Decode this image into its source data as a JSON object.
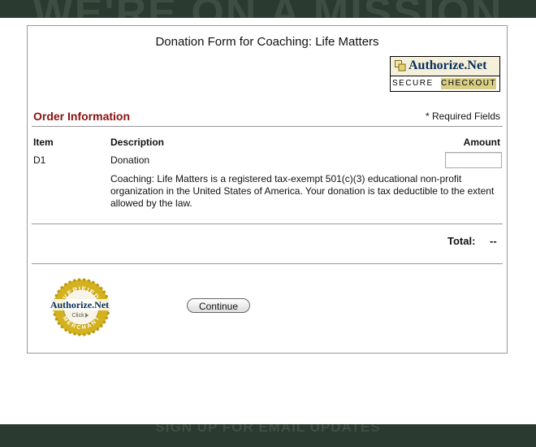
{
  "background": {
    "headline": "WE'RE ON A MISSION",
    "footer_text": "SIGN UP FOR EMAIL UPDATES"
  },
  "form": {
    "title": "Donation Form for Coaching: Life Matters",
    "secure_badge": {
      "brand": "Authorize.Net",
      "secure": "SECURE",
      "checkout": "CHECKOUT"
    },
    "section_title": "Order Information",
    "required_note": "* Required Fields",
    "columns": {
      "item": "Item",
      "description": "Description",
      "amount": "Amount"
    },
    "rows": [
      {
        "item": "D1",
        "description": "Donation",
        "amount": "",
        "note": "Coaching: Life Matters is a registered tax-exempt 501(c)(3) educational non-profit organization in the United States of America. Your donation is tax deductible to the extent allowed by the law."
      }
    ],
    "total_label": "Total:",
    "total_value": "--",
    "merchant_seal": {
      "top": "VERIFIED",
      "brand": "Authorize.Net",
      "click": "Click",
      "bottom": "MERCHANT"
    },
    "continue_label": "Continue"
  },
  "colors": {
    "section_title": "#8a1010",
    "badge_brand": "#0b2e5a",
    "checkout_band": "#d9ce86",
    "seal_gold": "#d4b21f"
  }
}
